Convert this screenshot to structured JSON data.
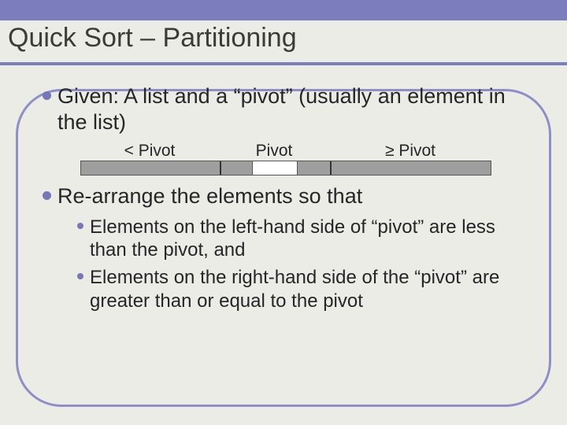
{
  "title": "Quick Sort – Partitioning",
  "b1": "Given: A list and a “pivot” (usually an element in the list)",
  "partition": {
    "lt": "< Pivot",
    "piv": "Pivot",
    "ge": "≥ Pivot"
  },
  "b2": "Re-arrange the elements so that",
  "sub1": "Elements on the left-hand side of “pivot” are less than the pivot, and",
  "sub2": "Elements on the right-hand side of the “pivot” are greater than or equal to the pivot"
}
